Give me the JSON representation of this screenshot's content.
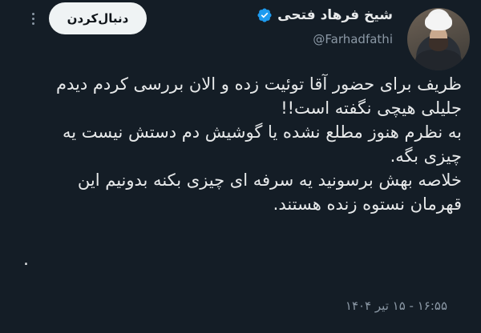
{
  "tweet": {
    "author": {
      "display_name": "شیخ فرهاد فتحی",
      "handle": "@Farhadfathi",
      "verified": true,
      "verified_color": "#1d9bf0"
    },
    "follow_label": "دنبال‌کردن",
    "more_icon": "more-vertical-icon",
    "body_lines": [
      "ظریف برای حضور آقا توئیت زده و الان بررسی کردم دیدم",
      "جلیلی هیچی نگفته است!!",
      "به نظرم هنوز مطلع نشده یا گوشیش دم دستش نیست یه",
      "چیزی بگه.",
      "خلاصه بهش برسونید یه سرفه ای چیزی بکنه بدونیم این",
      "قهرمان نستوه زنده هستند."
    ],
    "trailing_text": ".",
    "timestamp": "۱۶:۵۵ - ۱۵ تیر ۱۴۰۴"
  },
  "colors": {
    "background": "#141d26",
    "text": "#e7e9ea",
    "muted": "#8b98a5",
    "button_bg": "#eff3f4"
  }
}
